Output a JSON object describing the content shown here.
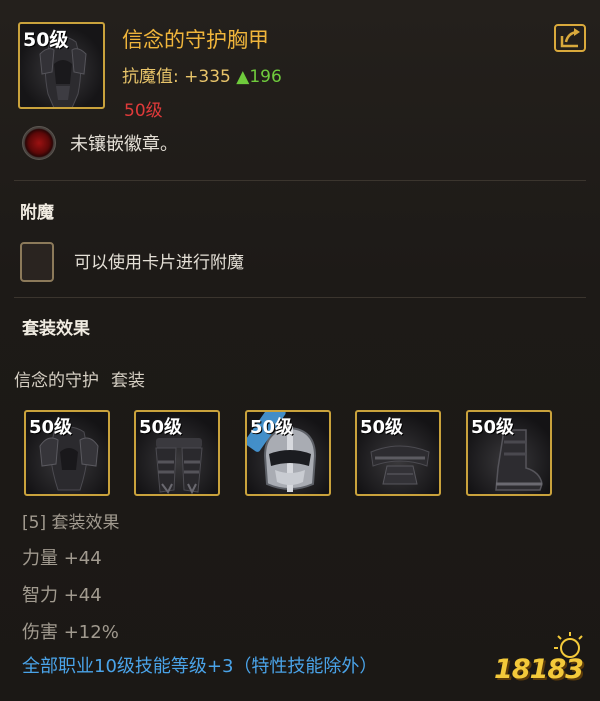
{
  "item": {
    "level_tag": "50级",
    "name": "信念的守护胸甲",
    "stat_label": "抗魔值:",
    "stat_value": "+335",
    "stat_delta": "▲196",
    "required_level": "50级",
    "socket_text": "未镶嵌徽章。",
    "icon": "chest-armor-icon"
  },
  "share_icon": "share-icon",
  "enchant": {
    "title": "附魔",
    "slot_text": "可以使用卡片进行附魔"
  },
  "set": {
    "title": "套装效果",
    "name": "信念的守护",
    "suffix": "套装",
    "pieces": [
      {
        "level": "50级",
        "icon": "shoulder-armor-icon"
      },
      {
        "level": "50级",
        "icon": "leg-armor-icon"
      },
      {
        "level": "50级",
        "icon": "helmet-icon",
        "badge": "已穿戴"
      },
      {
        "level": "50级",
        "icon": "belt-icon"
      },
      {
        "level": "50级",
        "icon": "boots-icon"
      }
    ],
    "effect_header": "[5] 套装效果",
    "bonuses": [
      "力量 +44",
      "智力 +44",
      "伤害 +12%"
    ],
    "skill_bonus": "全部职业10级技能等级+3（特性技能除外）"
  },
  "watermark": "18183",
  "colors": {
    "item_name": "#f0b53b",
    "stat": "#e8c46a",
    "stat_up": "#6fcb3c",
    "required_level": "#e03a3a",
    "skill_bonus": "#4aa3e8",
    "frame_gold": "#c9a23c"
  }
}
